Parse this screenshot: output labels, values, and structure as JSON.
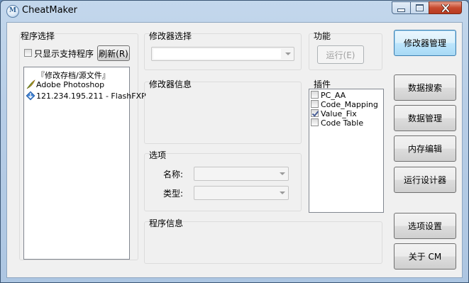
{
  "window": {
    "title": "CheatMaker",
    "icon": "app-logo-icon"
  },
  "program_select": {
    "group_label": "程序选择",
    "only_supported_label": "只显示支持程序",
    "only_supported_checked": false,
    "refresh_label": "刷新(R)",
    "tree_items": [
      {
        "label": "『修改存档/源文件』",
        "icon": ""
      },
      {
        "label": "Adobe Photoshop",
        "icon": "photoshop-feather-icon"
      },
      {
        "label": "121.234.195.211 - FlashFXP",
        "icon": "flashfxp-icon"
      }
    ]
  },
  "modifier_select": {
    "group_label": "修改器选择",
    "value": ""
  },
  "function": {
    "group_label": "功能",
    "run_label": "运行(E)"
  },
  "modifier_info": {
    "group_label": "修改器信息"
  },
  "plugins": {
    "group_label": "插件",
    "items": [
      {
        "label": "PC_AA",
        "checked": false
      },
      {
        "label": "Code_Mapping",
        "checked": false
      },
      {
        "label": "Value_Fix",
        "checked": true
      },
      {
        "label": "Code Table",
        "checked": false
      }
    ]
  },
  "options": {
    "group_label": "选项",
    "name_label": "名称:",
    "type_label": "类型:"
  },
  "program_info": {
    "group_label": "程序信息"
  },
  "right_buttons": {
    "modifier_mgmt": "修改器管理",
    "data_search": "数据搜索",
    "data_mgmt": "数据管理",
    "memory_edit": "内存编辑",
    "run_designer": "运行设计器",
    "option_settings": "选项设置",
    "about": "关于 CM"
  }
}
